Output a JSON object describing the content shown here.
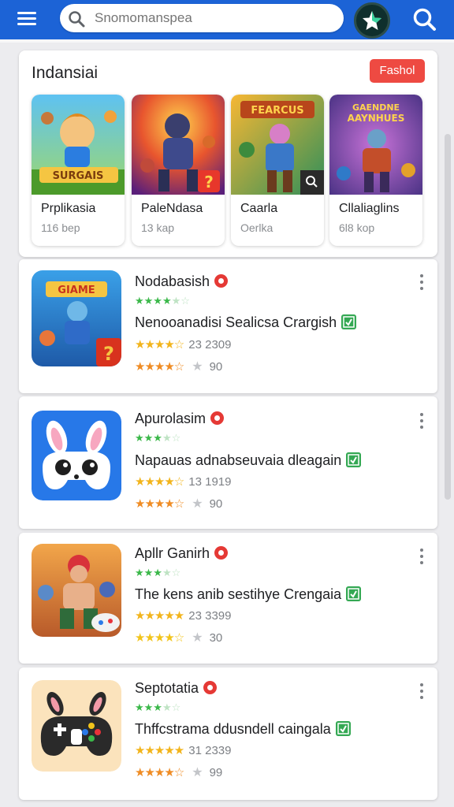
{
  "search": {
    "placeholder": "Snomomanspea"
  },
  "featured": {
    "title": "Indansiai",
    "button_label": "Fashol",
    "cards": [
      {
        "name": "Prplikasia",
        "size": "116 bep"
      },
      {
        "name": "PaleNdasa",
        "size": "13 kap"
      },
      {
        "name": "Caarla",
        "size": "Oerlka"
      },
      {
        "name": "Cllaliaglins",
        "size": "6l8 kop"
      }
    ]
  },
  "apps": [
    {
      "name": "Nodabasish",
      "description": "Nenooanadisi Sealicsa Crargish",
      "downloads": "23 2309",
      "reviews": "90"
    },
    {
      "name": "Apurolasim",
      "description": "Napauas adnabseuvaia dleagain",
      "downloads": "13 1919",
      "reviews": "90"
    },
    {
      "name": "Apllr Ganirh",
      "description": "The kens anib sestihye Crengaia",
      "downloads": "23 3399",
      "reviews": "30"
    },
    {
      "name": "Septotatia",
      "description": "Thffcstrama ddusndell caingala",
      "downloads": "31 2339",
      "reviews": "99"
    }
  ],
  "colors": {
    "topbar": "#1c63d6",
    "accent_red": "#ee4a42",
    "green": "#34a853",
    "star_yellow": "#f2b41b"
  }
}
